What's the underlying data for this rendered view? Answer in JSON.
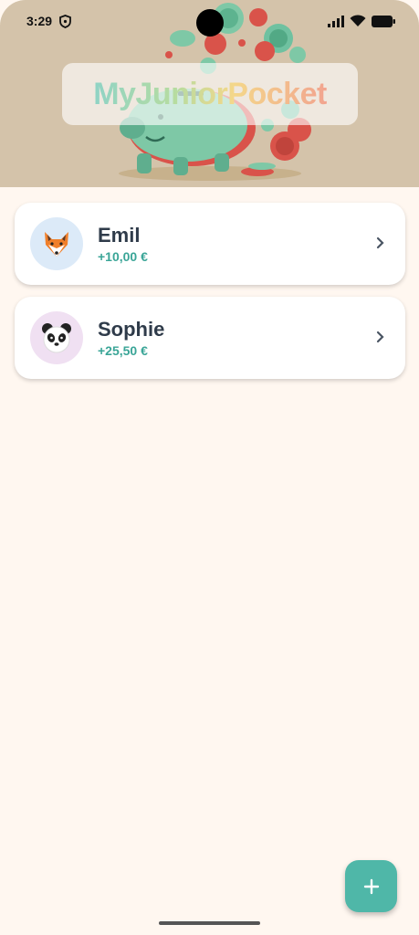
{
  "status_bar": {
    "time": "3:29"
  },
  "header": {
    "app_title": "MyJuniorPocket"
  },
  "children": [
    {
      "name": "Emil",
      "balance": "+10,00 €",
      "avatar_icon": "fox-icon",
      "avatar_bg": "#dceaf8"
    },
    {
      "name": "Sophie",
      "balance": "+25,50 €",
      "avatar_icon": "panda-icon",
      "avatar_bg": "#f0e0f2"
    }
  ],
  "fab": {
    "icon": "plus-icon"
  },
  "colors": {
    "accent": "#4fb7a8",
    "amount": "#3aa597",
    "background": "#fff7f0",
    "header_bg": "#d4c3aa"
  }
}
